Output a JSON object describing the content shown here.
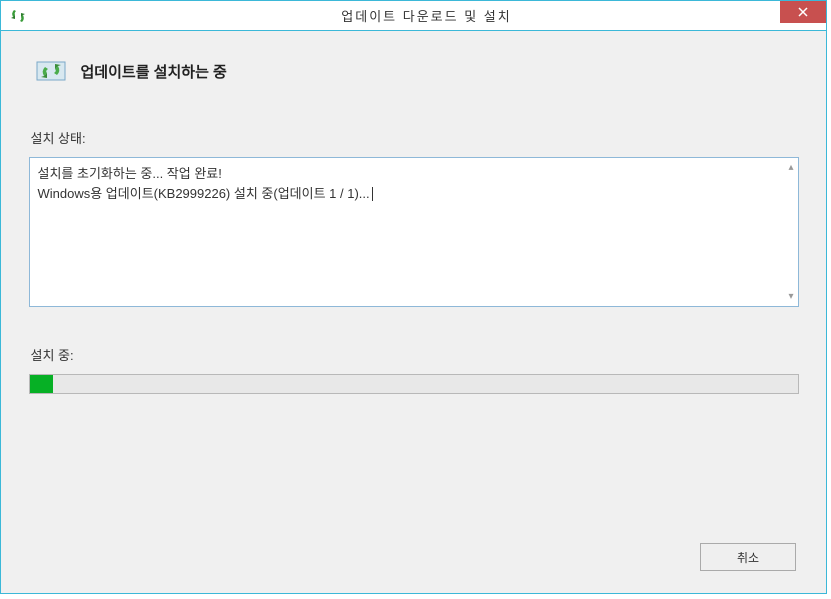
{
  "window": {
    "title": "업데이트 다운로드 및 설치"
  },
  "header": {
    "title": "업데이트를 설치하는 중"
  },
  "status": {
    "label": "설치 상태:",
    "line1": "설치를 초기화하는 중... 작업 완료!",
    "line2": "Windows용 업데이트(KB2999226) 설치 중(업데이트 1 / 1)..."
  },
  "progress": {
    "label": "설치 중:",
    "percent": 3
  },
  "buttons": {
    "cancel": "취소"
  }
}
